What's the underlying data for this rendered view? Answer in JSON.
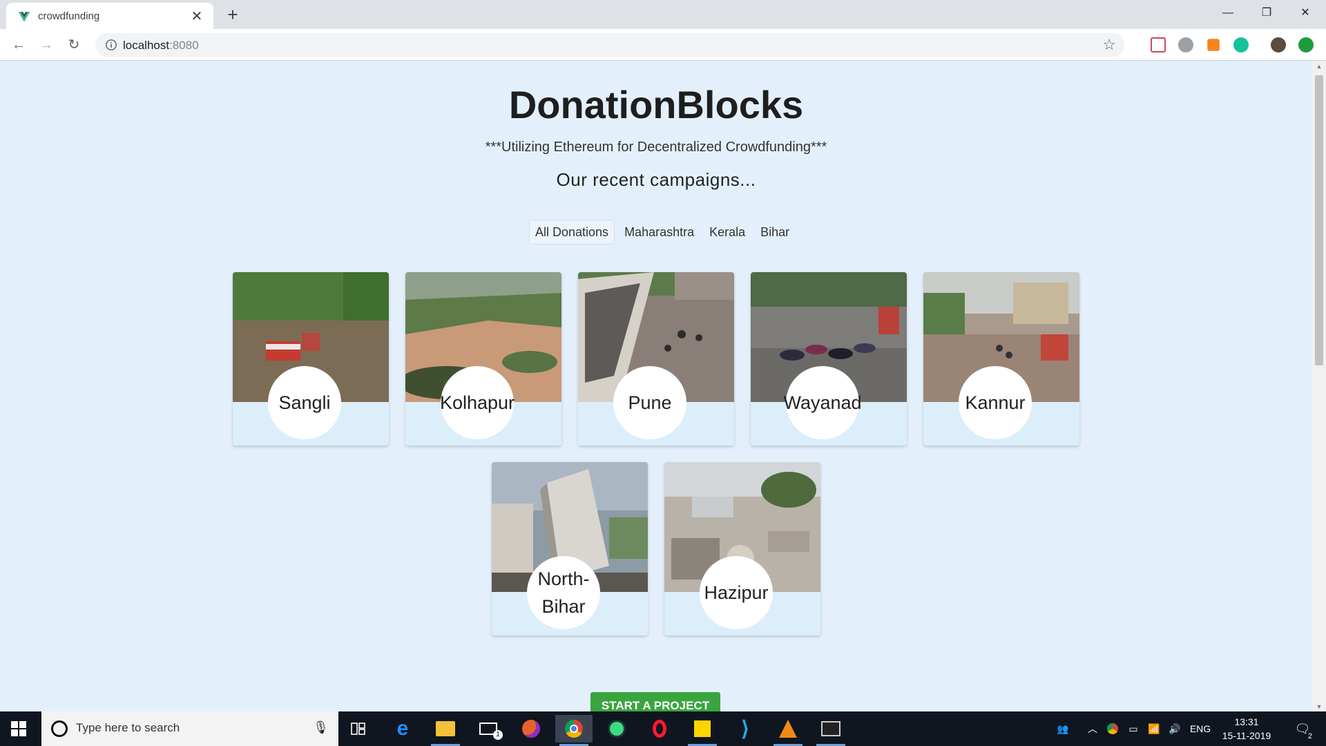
{
  "browser": {
    "tab_title": "crowdfunding",
    "tab_close": "✕",
    "new_tab": "+",
    "url_host": "localhost",
    "url_port": ":8080",
    "window_controls": {
      "minimize": "—",
      "restore": "❐",
      "close": "✕"
    }
  },
  "page": {
    "title": "DonationBlocks",
    "subtitle": "***Utilizing Ethereum for Decentralized Crowdfunding***",
    "recent_heading": "Our recent campaigns...",
    "filters": [
      "All Donations",
      "Maharashtra",
      "Kerala",
      "Bihar"
    ],
    "active_filter": "All Donations",
    "campaigns": [
      {
        "name": "Sangli"
      },
      {
        "name": "Kolhapur"
      },
      {
        "name": "Pune"
      },
      {
        "name": "Wayanad"
      },
      {
        "name": "Kannur"
      },
      {
        "name_line1": "North-",
        "name_line2": "Bihar"
      },
      {
        "name": "Hazipur"
      }
    ],
    "start_button": "START A PROJECT"
  },
  "taskbar": {
    "search_placeholder": "Type here to search",
    "language": "ENG",
    "time": "13:31",
    "date": "15-11-2019",
    "notifications": "2",
    "mail_badge": "1"
  },
  "colors": {
    "page_bg": "#e3f0fc",
    "start_button": "#3aa53e",
    "taskbar": "#0f1620"
  }
}
